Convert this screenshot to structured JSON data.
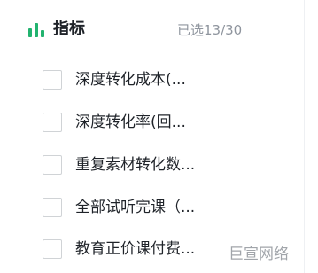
{
  "header": {
    "title": "指标",
    "count": "已选13/30"
  },
  "items": [
    {
      "label": "深度转化成本(...",
      "checked": false
    },
    {
      "label": "深度转化率(回...",
      "checked": false
    },
    {
      "label": "重复素材转化数...",
      "checked": false
    },
    {
      "label": "全部试听完课（...",
      "checked": false
    },
    {
      "label": "教育正价课付费...",
      "checked": false
    }
  ],
  "watermark": "巨宣网络",
  "colors": {
    "accent": "#22b36f",
    "text": "#1f2329",
    "muted": "#8f959e",
    "checkbox_border": "#d0d3d6"
  }
}
